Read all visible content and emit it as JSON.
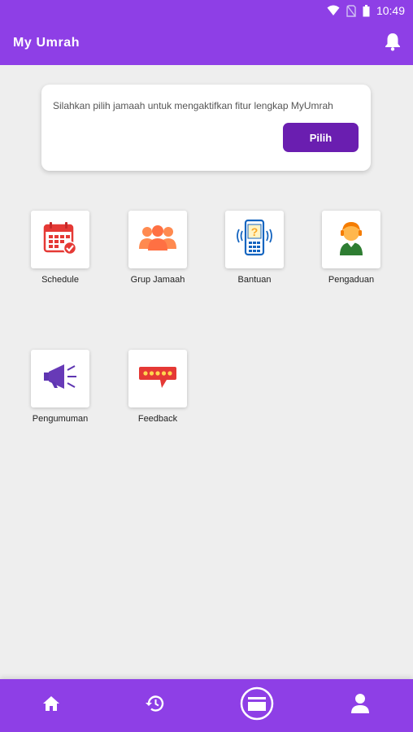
{
  "status_bar": {
    "time": "10:49"
  },
  "app_bar": {
    "title": "My Umrah"
  },
  "prompt_card": {
    "message": "Silahkan pilih jamaah untuk mengaktifkan fitur lengkap MyUmrah",
    "button_label": "Pilih"
  },
  "menu": {
    "items": [
      {
        "label": "Schedule",
        "icon": "calendar-icon"
      },
      {
        "label": "Grup Jamaah",
        "icon": "group-icon"
      },
      {
        "label": "Bantuan",
        "icon": "phone-help-icon"
      },
      {
        "label": "Pengaduan",
        "icon": "agent-icon"
      },
      {
        "label": "Pengumuman",
        "icon": "megaphone-icon"
      },
      {
        "label": "Feedback",
        "icon": "feedback-stars-icon"
      }
    ]
  },
  "bottom_nav": {
    "items": [
      "home-icon",
      "history-icon",
      "umrah-logo-icon",
      "profile-icon"
    ]
  },
  "colors": {
    "primary": "#8e3fe6",
    "button": "#6a1eb0",
    "background": "#eeeeee"
  }
}
